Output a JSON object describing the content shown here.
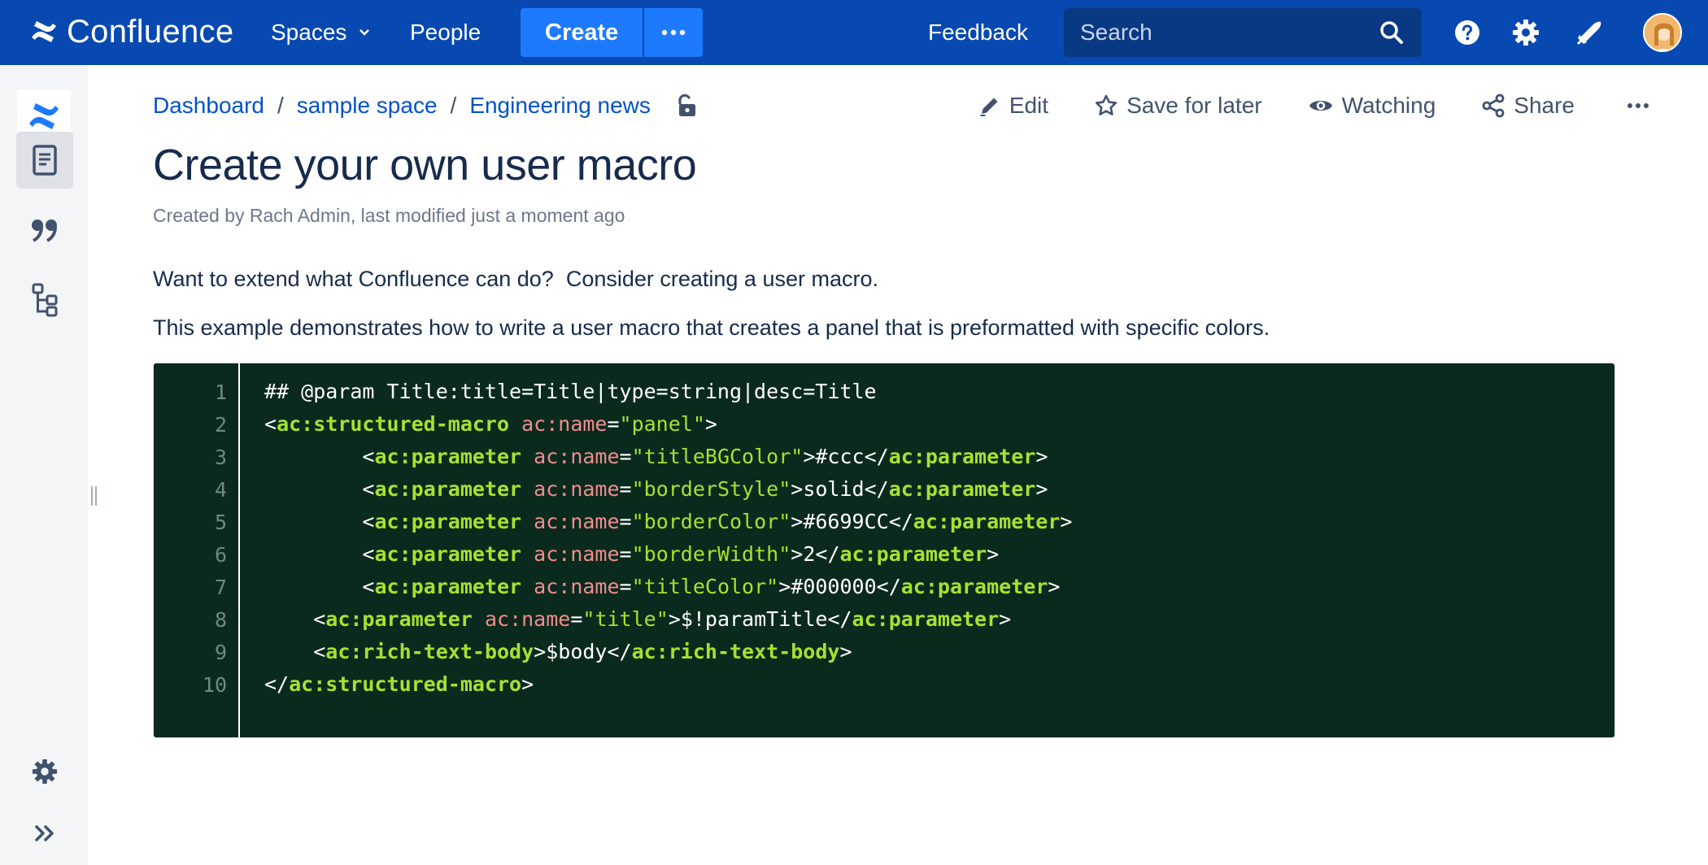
{
  "topnav": {
    "brand": "Confluence",
    "spaces": "Spaces",
    "people": "People",
    "create": "Create",
    "feedback": "Feedback",
    "search_placeholder": "Search",
    "icons": [
      "confluence-logo-icon",
      "chevron-down-icon",
      "more-icon",
      "search-icon",
      "help-icon",
      "settings-icon",
      "notifications-icon"
    ],
    "colors": {
      "bar": "#0749b0",
      "create": "#1d7afc",
      "search": "#0a3983"
    }
  },
  "sidebar": {
    "icons": [
      "space-logo-icon",
      "pages-icon",
      "blog-quote-icon",
      "page-tree-icon",
      "space-settings-icon",
      "expand-sidebar-icon"
    ]
  },
  "breadcrumb": [
    "Dashboard",
    "sample space",
    "Engineering news"
  ],
  "actions": {
    "edit": "Edit",
    "save": "Save for later",
    "watching": "Watching",
    "share": "Share"
  },
  "page": {
    "title": "Create your own user macro",
    "byline": "Created by Rach Admin, last modified just a moment ago",
    "paragraph1": "Want to extend what Confluence can do?  Consider creating a user macro.",
    "paragraph2": "This example demonstrates how to write a user macro that creates a panel that is preformatted with specific colors."
  },
  "code_block": {
    "background": "#0b2a1e",
    "line_numbers": [
      "1",
      "2",
      "3",
      "4",
      "5",
      "6",
      "7",
      "8",
      "9",
      "10"
    ],
    "lines": [
      "## @param Title:title=Title|type=string|desc=Title",
      "<ac:structured-macro ac:name=\"panel\">",
      "        <ac:parameter ac:name=\"titleBGColor\">#ccc</ac:parameter>",
      "        <ac:parameter ac:name=\"borderStyle\">solid</ac:parameter>",
      "        <ac:parameter ac:name=\"borderColor\">#6699CC</ac:parameter>",
      "        <ac:parameter ac:name=\"borderWidth\">2</ac:parameter>",
      "        <ac:parameter ac:name=\"titleColor\">#000000</ac:parameter>",
      "    <ac:parameter ac:name=\"title\">$!paramTitle</ac:parameter>",
      "    <ac:rich-text-body>$body</ac:rich-text-body>",
      "</ac:structured-macro>"
    ]
  }
}
